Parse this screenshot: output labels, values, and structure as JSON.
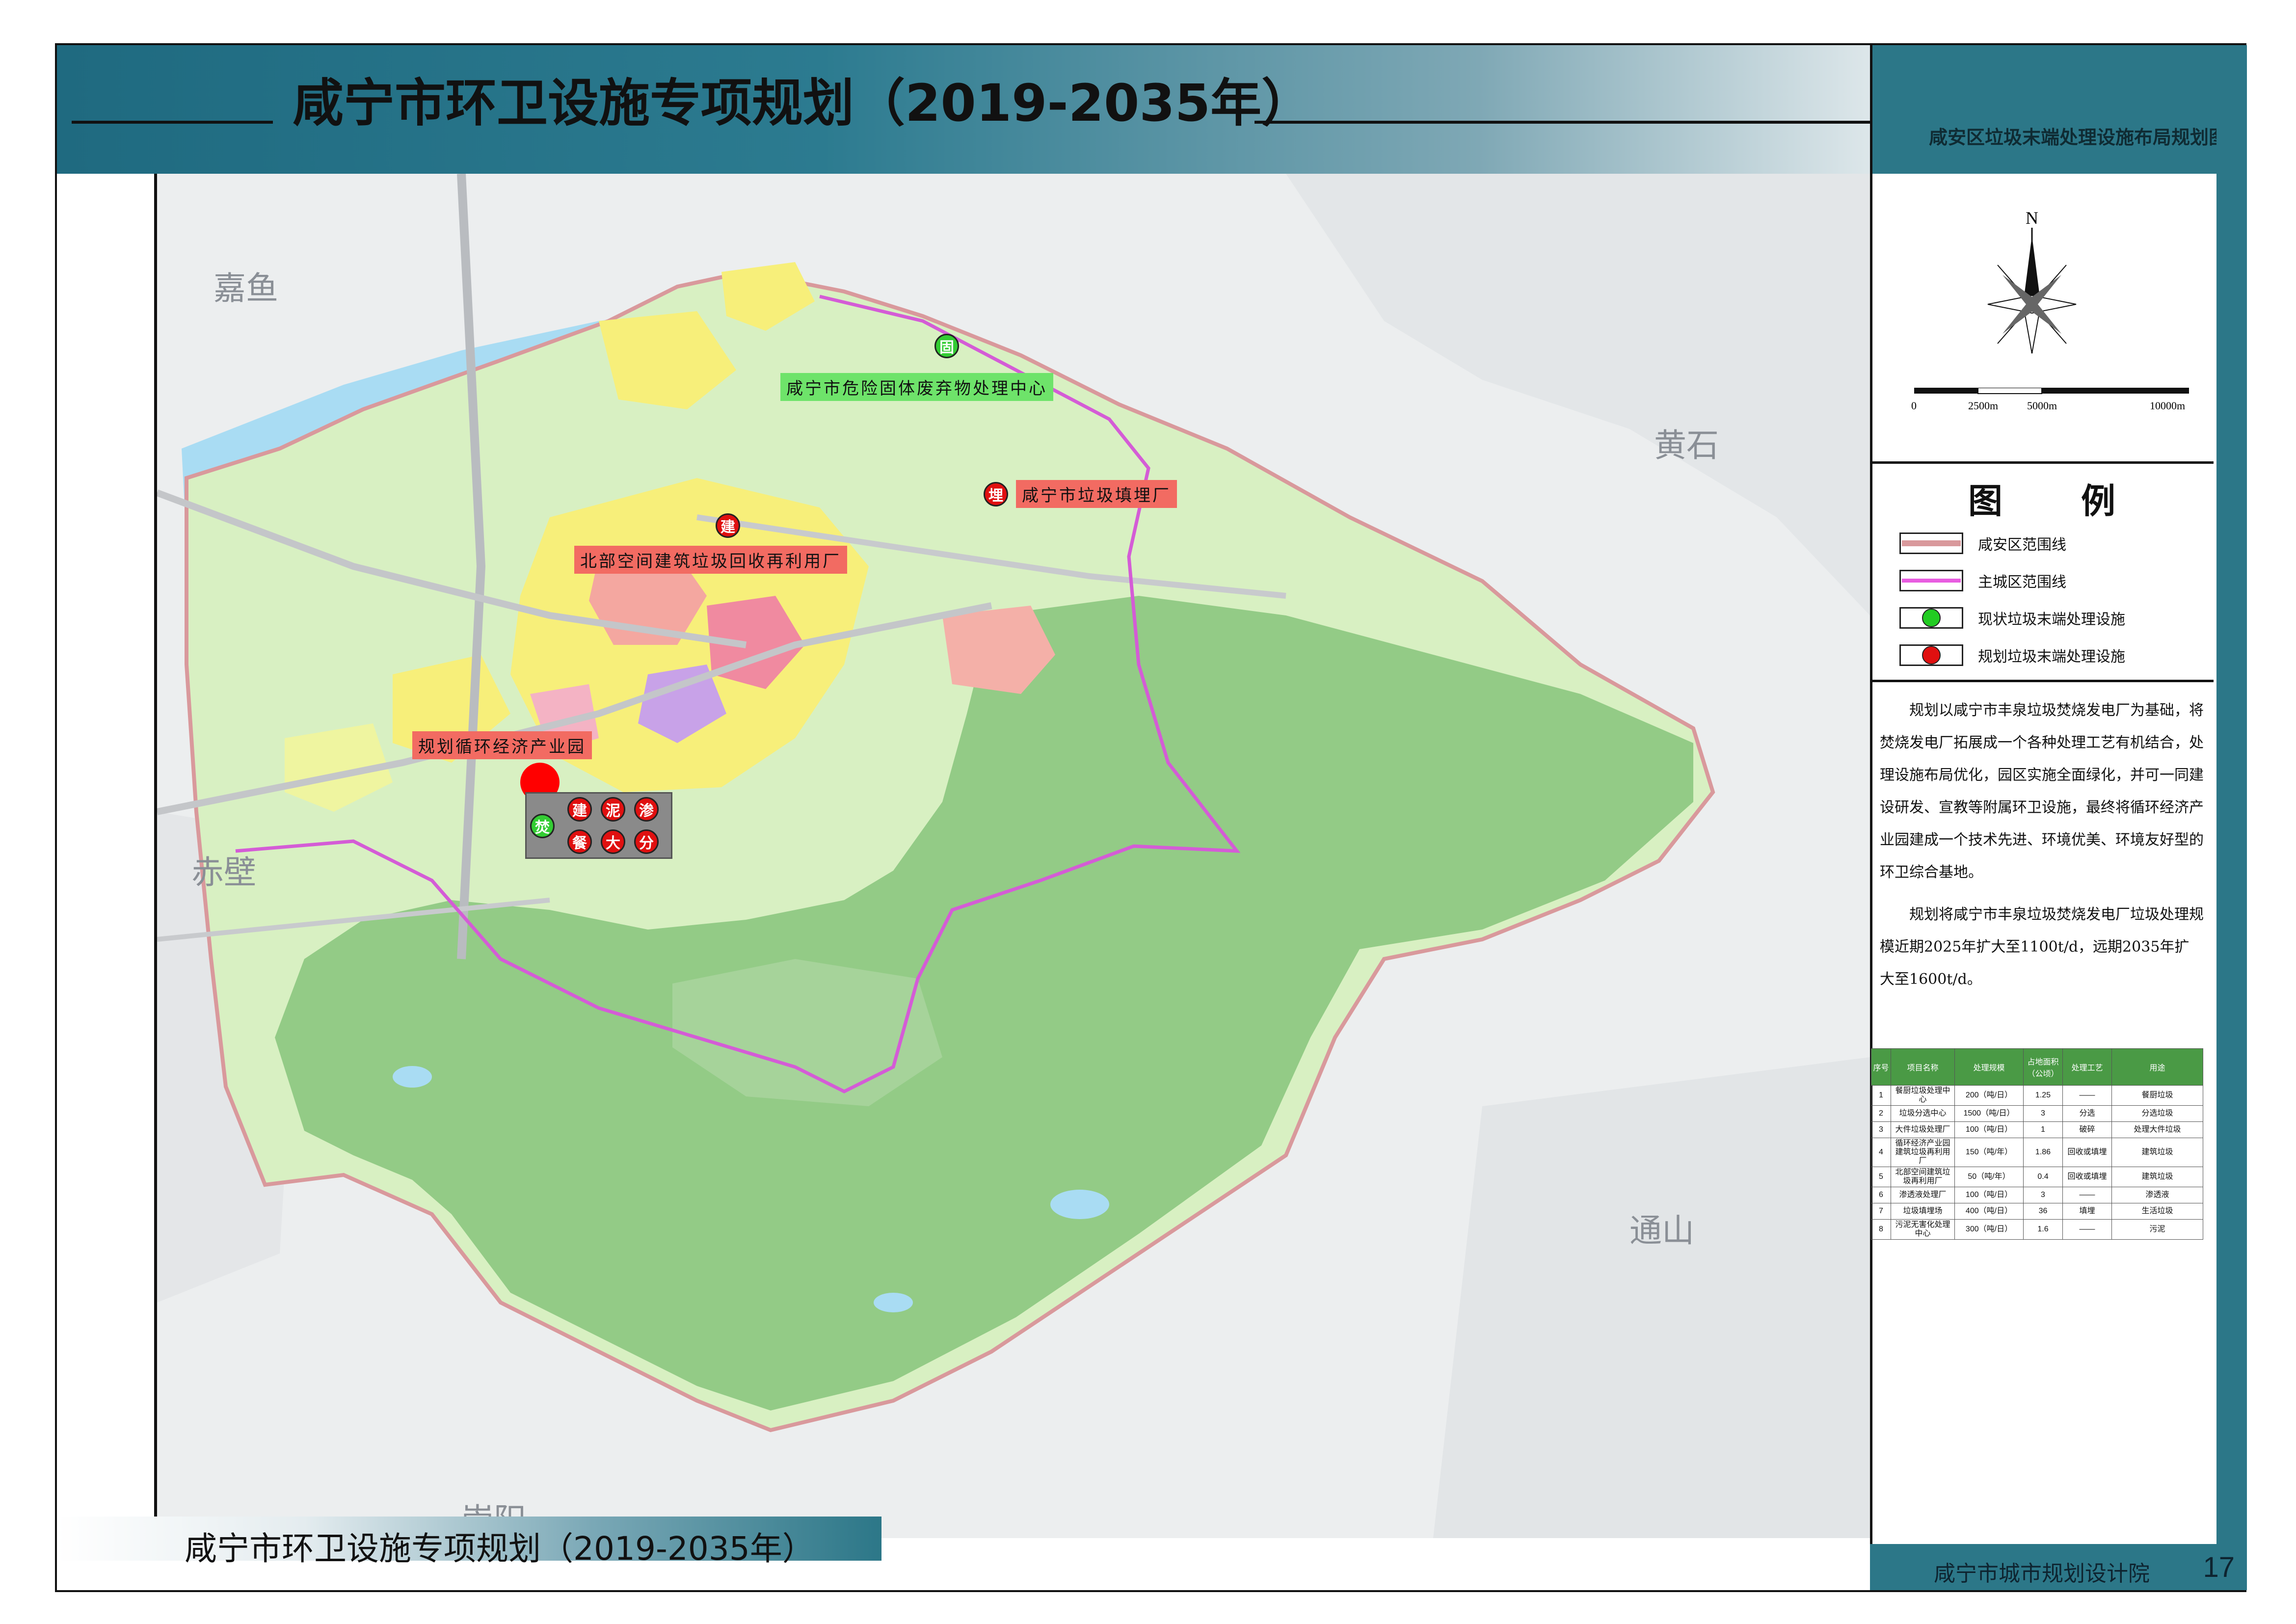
{
  "header": {
    "title": "咸宁市环卫设施专项规划（2019-2035年）",
    "subtitle": "咸安区垃圾末端处理设施布局规划图"
  },
  "compass": {
    "north": "N"
  },
  "scale": {
    "labels": [
      "0",
      "2500m",
      "5000m",
      "10000m"
    ]
  },
  "legend": {
    "title": "图例",
    "items": [
      {
        "label": "咸安区范围线",
        "swatch": "district-boundary-line",
        "color": "#d9999c"
      },
      {
        "label": "主城区范围线",
        "swatch": "urban-boundary-line",
        "color": "#e85ce0"
      },
      {
        "label": "现状垃圾末端处理设施",
        "swatch": "existing-facility-dot",
        "color": "#22cc22"
      },
      {
        "label": "规划垃圾末端处理设施",
        "swatch": "planned-facility-dot",
        "color": "#e01010"
      }
    ]
  },
  "description": [
    "规划以咸宁市丰泉垃圾焚烧发电厂为基础，将焚烧发电厂拓展成一个各种处理工艺有机结合，处理设施布局优化，园区实施全面绿化，并可一同建设研发、宣教等附属环卫设施，最终将循环经济产业园建成一个技术先进、环境优美、环境友好型的环卫综合基地。",
    "规划将咸宁市丰泉垃圾焚烧发电厂垃圾处理规模近期2025年扩大至1100t/d，远期2035年扩大至1600t/d。"
  ],
  "table": {
    "headers": [
      "序号",
      "项目名称",
      "处理规模",
      "占地面积（公顷）",
      "处理工艺",
      "用途"
    ],
    "rows": [
      [
        "1",
        "餐厨垃圾处理中心",
        "200（吨/日）",
        "1.25",
        "——",
        "餐厨垃圾"
      ],
      [
        "2",
        "垃圾分选中心",
        "1500（吨/日）",
        "3",
        "分选",
        "分选垃圾"
      ],
      [
        "3",
        "大件垃圾处理厂",
        "100（吨/日）",
        "1",
        "破碎",
        "处理大件垃圾"
      ],
      [
        "4",
        "循环经济产业园建筑垃圾再利用厂",
        "150（吨/年）",
        "1.86",
        "回收或填埋",
        "建筑垃圾"
      ],
      [
        "5",
        "北部空间建筑垃圾再利用厂",
        "50（吨/年）",
        "0.4",
        "回收或填埋",
        "建筑垃圾"
      ],
      [
        "6",
        "渗透液处理厂",
        "100（吨/日）",
        "3",
        "——",
        "渗透液"
      ],
      [
        "7",
        "垃圾填埋场",
        "400（吨/日）",
        "36",
        "填埋",
        "生活垃圾"
      ],
      [
        "8",
        "污泥无害化处理中心",
        "300（吨/日）",
        "1.6",
        "——",
        "污泥"
      ]
    ]
  },
  "map": {
    "places": [
      "嘉鱼",
      "黄石",
      "赤壁",
      "通山",
      "崇阳"
    ],
    "facility_labels": {
      "hazardous": "咸宁市危险固体废弃物处理中心",
      "landfill": "咸宁市垃圾填埋厂",
      "north_construction": "北部空间建筑垃圾回收再利用厂",
      "industrial_park": "规划循环经济产业园"
    },
    "markers": {
      "hazardous": "固",
      "landfill": "埋",
      "north_construction": "建",
      "park_existing": "焚",
      "park_planned": [
        "建",
        "泥",
        "渗",
        "餐",
        "大",
        "分"
      ]
    }
  },
  "footer": {
    "title": "咸宁市环卫设施专项规划（2019-2035年）",
    "org": "咸宁市城市规划设计院",
    "page": "17"
  }
}
